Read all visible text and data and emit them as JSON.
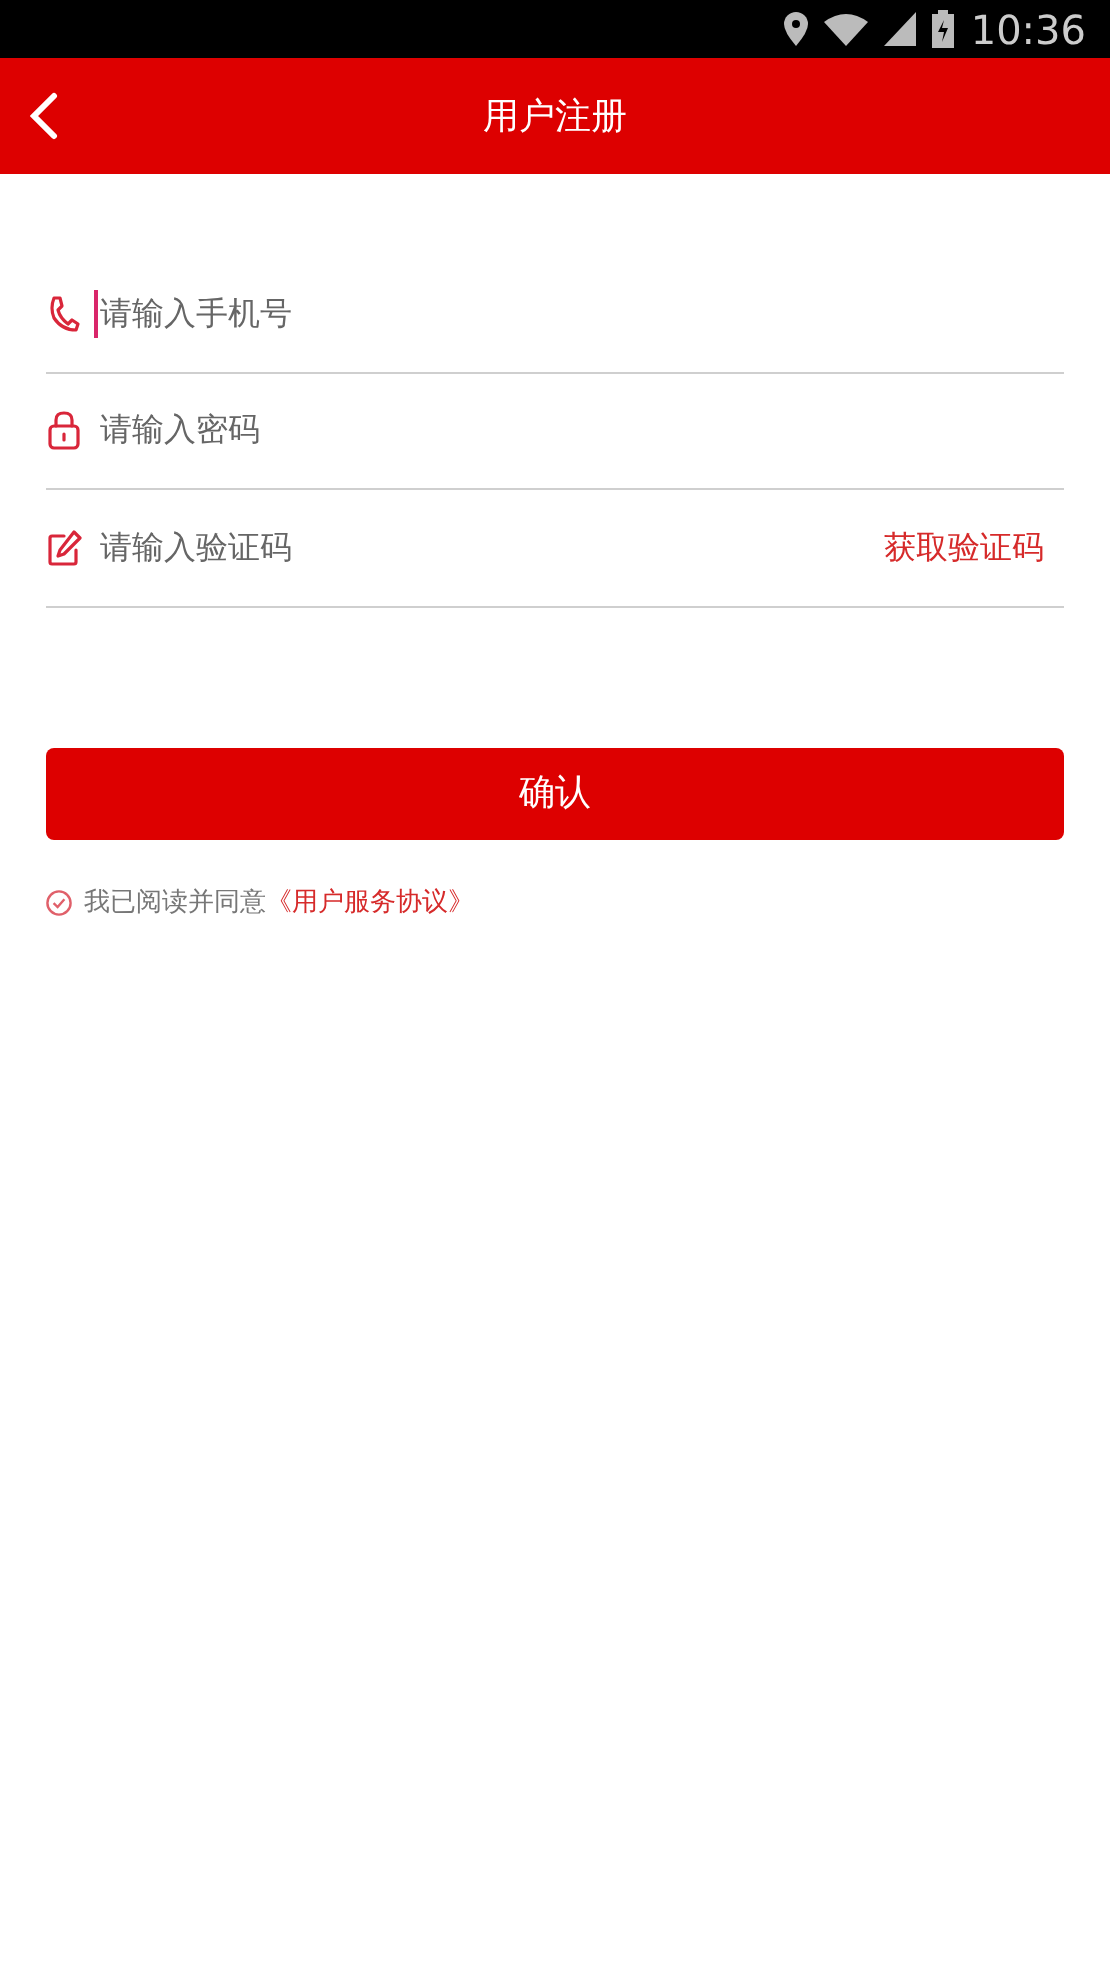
{
  "status_bar": {
    "time": "10:36"
  },
  "header": {
    "title": "用户注册"
  },
  "fields": [
    {
      "kind": "phone",
      "placeholder": "请输入手机号",
      "focused": true
    },
    {
      "kind": "lock",
      "placeholder": "请输入密码",
      "focused": false
    },
    {
      "kind": "edit",
      "placeholder": "请输入验证码",
      "focused": false,
      "action": "获取验证码"
    }
  ],
  "confirm_button": "确认",
  "agreement": {
    "checked": true,
    "text": "我已阅读并同意",
    "link": "《用户服务协议》"
  }
}
